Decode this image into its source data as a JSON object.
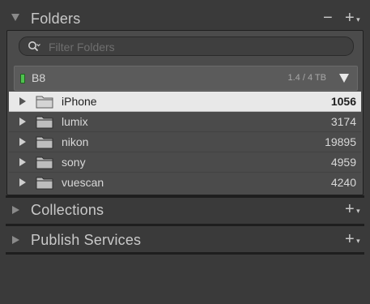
{
  "folders_panel": {
    "title": "Folders",
    "minus_button": "−",
    "plus_button": "+",
    "search": {
      "placeholder": "Filter Folders",
      "value": ""
    },
    "volume": {
      "name": "B8",
      "usage": "1.4 / 4 TB",
      "status_color": "#4fc14f"
    },
    "items": [
      {
        "name": "iPhone",
        "count": "1056",
        "selected": true
      },
      {
        "name": "lumix",
        "count": "3174"
      },
      {
        "name": "nikon",
        "count": "19895"
      },
      {
        "name": "sony",
        "count": "4959"
      },
      {
        "name": "vuescan",
        "count": "4240"
      }
    ]
  },
  "collections_panel": {
    "title": "Collections",
    "plus_button": "+"
  },
  "publish_panel": {
    "title": "Publish Services",
    "plus_button": "+"
  },
  "icons": {
    "expanded": "triangle-down-icon",
    "collapsed": "triangle-right-icon",
    "folder": "folder-icon",
    "search": "search-icon",
    "volume_menu": "triangle-down-icon"
  }
}
